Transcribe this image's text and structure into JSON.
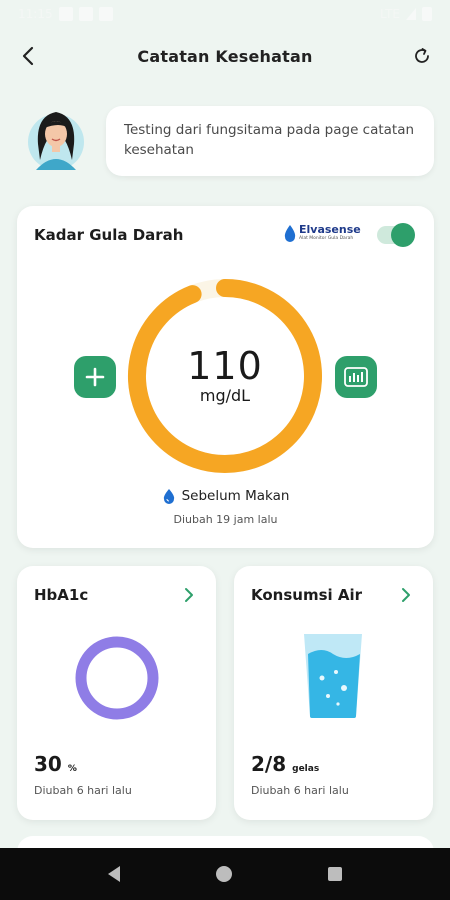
{
  "status_bar": {
    "time": "11:15",
    "network": "LTE"
  },
  "header": {
    "title": "Catatan Kesehatan"
  },
  "greeting": {
    "message": "Testing dari fungsitama pada page catatan kesehatan"
  },
  "glucose": {
    "title": "Kadar Gula Darah",
    "brand_name": "Elvasense",
    "brand_tagline": "Alat Monitor Gula Darah",
    "value": "110",
    "unit": "mg/dL",
    "meal_status": "Sebelum Makan",
    "updated": "Diubah 19 jam lalu",
    "gauge_fraction": 0.94,
    "toggle_on": true
  },
  "hba1c": {
    "title": "HbA1c",
    "value": "30",
    "unit": "%",
    "updated": "Diubah 6 hari lalu"
  },
  "water": {
    "title": "Konsumsi Air",
    "value": "2/8",
    "unit": "gelas",
    "updated": "Diubah 6 hari lalu",
    "fill_fraction": 0.25
  },
  "colors": {
    "accent_green": "#2e9f6b",
    "gauge_orange": "#f6a623",
    "gauge_track": "#fbf5e6",
    "hba1c_ring": "#8f7de6",
    "water_blue": "#35b6e5",
    "background": "#eef5f1"
  },
  "icons": {
    "back": "arrow-left-icon",
    "refresh": "refresh-icon",
    "add": "plus-icon",
    "stats": "bar-chart-icon",
    "meal": "water-drop-icon",
    "chevron": "chevron-right-icon"
  }
}
